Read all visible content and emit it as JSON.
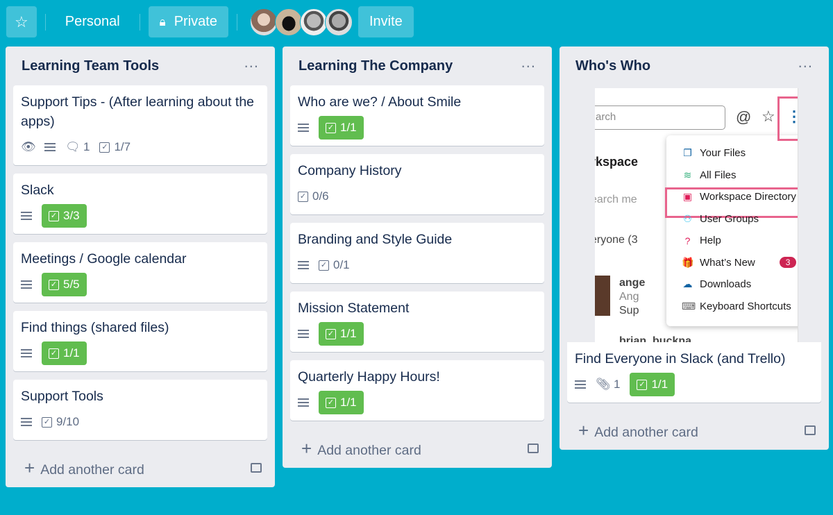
{
  "topbar": {
    "star_icon": "star-icon",
    "personal": "Personal",
    "private": "Private",
    "invite": "Invite",
    "avatars": 4
  },
  "colors": {
    "background": "#00AECC",
    "complete": "#61BD4F",
    "highlight": "#E8648D",
    "list": "#EBECF0"
  },
  "add_card_label": "Add another card",
  "lists": [
    {
      "title": "Learning Team Tools",
      "cards": [
        {
          "title": "Support Tips - (After learning about the apps)",
          "badges": [
            {
              "icon": "eye"
            },
            {
              "icon": "description"
            },
            {
              "icon": "comment",
              "text": "1"
            },
            {
              "icon": "checklist",
              "text": "1/7"
            }
          ]
        },
        {
          "title": "Slack",
          "badges": [
            {
              "icon": "description"
            },
            {
              "icon": "checklist",
              "text": "3/3",
              "done": true
            }
          ]
        },
        {
          "title": "Meetings / Google calendar",
          "badges": [
            {
              "icon": "description"
            },
            {
              "icon": "checklist",
              "text": "5/5",
              "done": true
            }
          ]
        },
        {
          "title": "Find things (shared files)",
          "badges": [
            {
              "icon": "description"
            },
            {
              "icon": "checklist",
              "text": "1/1",
              "done": true
            }
          ]
        },
        {
          "title": "Support Tools",
          "badges": [
            {
              "icon": "description"
            },
            {
              "icon": "checklist",
              "text": "9/10"
            }
          ]
        }
      ]
    },
    {
      "title": "Learning The Company",
      "cards": [
        {
          "title": "Who are we? / About Smile",
          "badges": [
            {
              "icon": "description"
            },
            {
              "icon": "checklist",
              "text": "1/1",
              "done": true
            }
          ]
        },
        {
          "title": "Company History",
          "badges": [
            {
              "icon": "checklist",
              "text": "0/6"
            }
          ]
        },
        {
          "title": "Branding and Style Guide",
          "badges": [
            {
              "icon": "description"
            },
            {
              "icon": "checklist",
              "text": "0/1"
            }
          ]
        },
        {
          "title": "Mission Statement",
          "badges": [
            {
              "icon": "description"
            },
            {
              "icon": "checklist",
              "text": "1/1",
              "done": true
            }
          ]
        },
        {
          "title": "Quarterly Happy Hours!",
          "badges": [
            {
              "icon": "description"
            },
            {
              "icon": "checklist",
              "text": "1/1",
              "done": true
            }
          ]
        }
      ]
    },
    {
      "title": "Who's Who",
      "cards": [
        {
          "title": "Find Everyone in Slack (and Trello)",
          "cover": true,
          "badges": [
            {
              "icon": "description"
            },
            {
              "icon": "attachment",
              "text": "1"
            },
            {
              "icon": "checklist",
              "text": "1/1",
              "done": true
            }
          ]
        }
      ]
    }
  ],
  "cover_screenshot": {
    "search_placeholder": "arch",
    "workspace": "rkspace",
    "search_members": "earch me",
    "everyone": "eryone (3",
    "user1": "ange",
    "user1_name": "Ang",
    "user1_title": "Sup",
    "user2": "brian_buckna",
    "menu": [
      {
        "label": "Your Files",
        "icon": "files-icon",
        "color": "#1264A3",
        "glyph": "❐"
      },
      {
        "label": "All Files",
        "icon": "layers-icon",
        "color": "#2BAC76",
        "glyph": "≋"
      },
      {
        "label": "Workspace Directory",
        "icon": "directory-icon",
        "color": "#E01E5A",
        "glyph": "▣",
        "highlighted": true
      },
      {
        "label": "User Groups",
        "icon": "user-groups-icon",
        "color": "#36C5F0",
        "glyph": "⚇"
      },
      {
        "label": "Help",
        "icon": "help-icon",
        "color": "#E01E5A",
        "glyph": "?"
      },
      {
        "label": "What’s New",
        "icon": "gift-icon",
        "color": "#ECB22E",
        "glyph": "🎁",
        "badge": "3"
      },
      {
        "label": "Downloads",
        "icon": "download-cloud-icon",
        "color": "#1264A3",
        "glyph": "☁"
      },
      {
        "label": "Keyboard Shortcuts",
        "icon": "keyboard-icon",
        "color": "#616061",
        "glyph": "⌨"
      }
    ]
  }
}
